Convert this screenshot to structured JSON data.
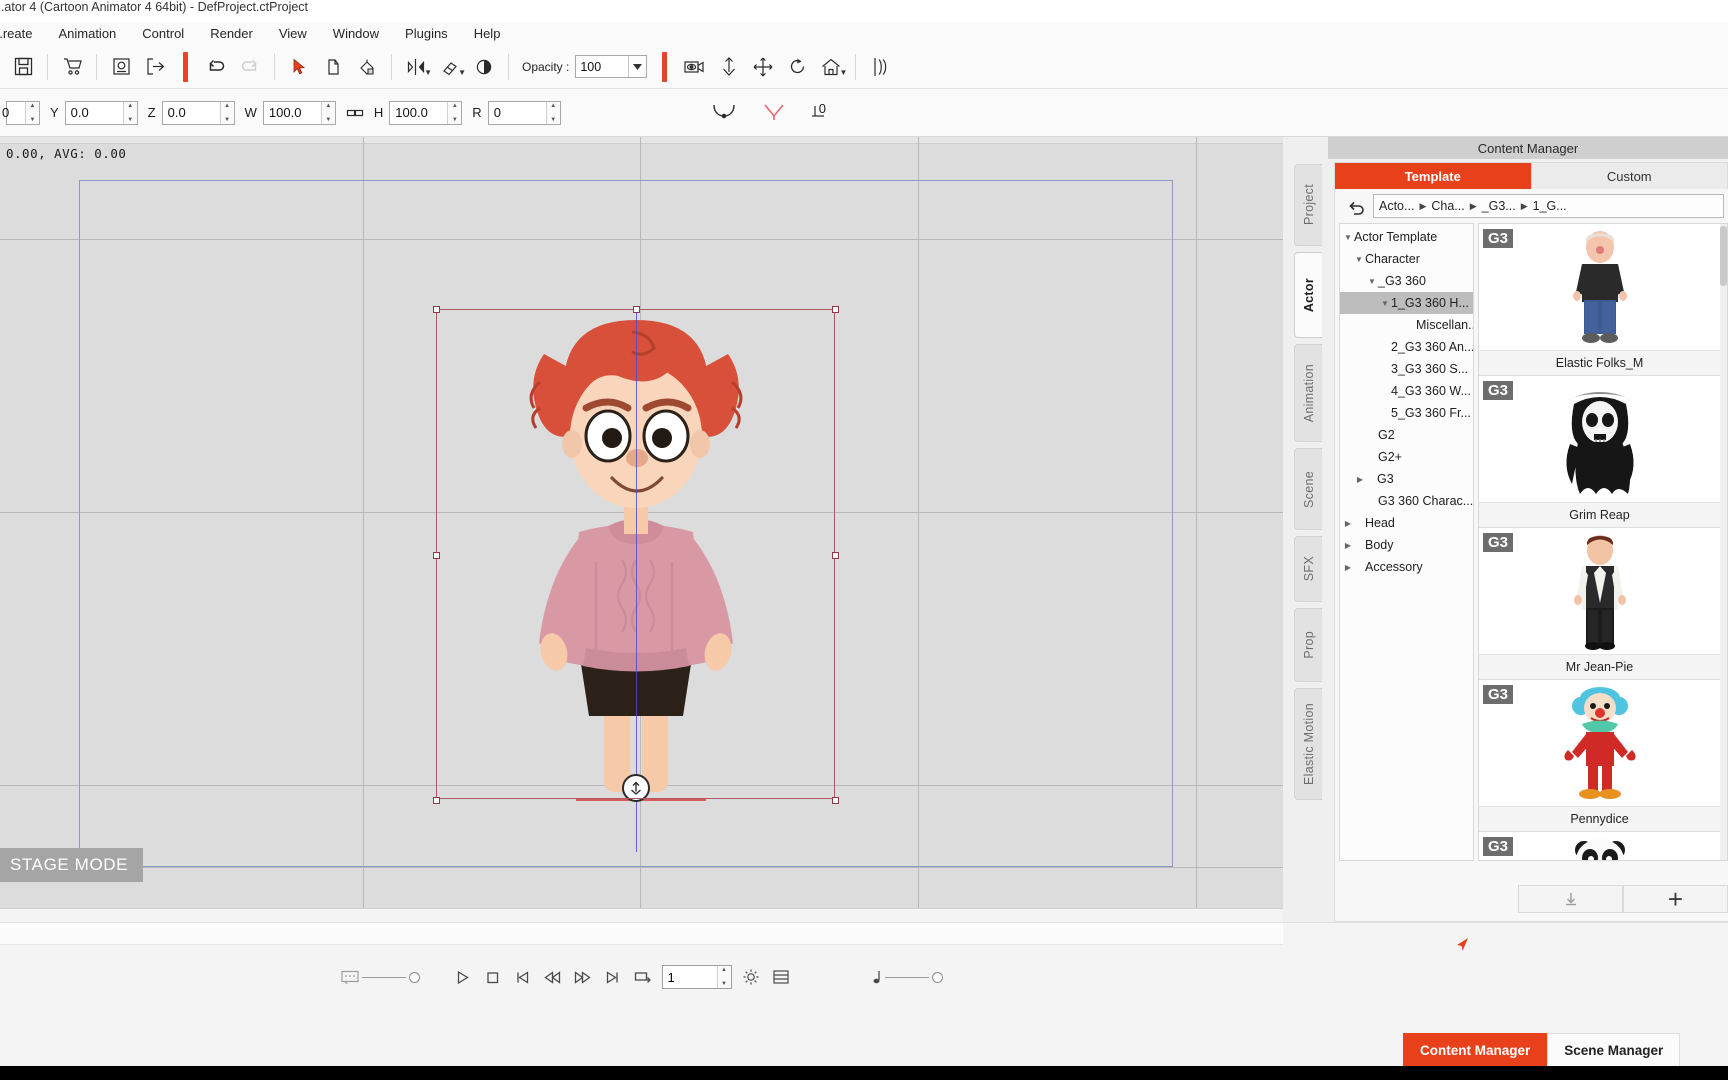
{
  "window": {
    "title": "...ator 4  (Cartoon Animator 4 64bit) - DefProject.ctProject"
  },
  "menu": {
    "items": [
      {
        "label": "...reate"
      },
      {
        "label": "Animation"
      },
      {
        "label": "Control"
      },
      {
        "label": "Render"
      },
      {
        "label": "View"
      },
      {
        "label": "Window"
      },
      {
        "label": "Plugins"
      },
      {
        "label": "Help"
      }
    ]
  },
  "toolbar": {
    "save_label": "save-icon",
    "opacity_label": "Opacity :",
    "opacity_value": "100"
  },
  "transform": {
    "fields": [
      {
        "key": "",
        "value": "0"
      },
      {
        "key": "Y",
        "value": "0.0"
      },
      {
        "key": "Z",
        "value": "0.0"
      },
      {
        "key": "W",
        "value": "100.0"
      },
      {
        "key": "H",
        "value": "100.0"
      },
      {
        "key": "R",
        "value": "0"
      }
    ],
    "angle_value": "0"
  },
  "viewport": {
    "readout": "0.00,  AVG: 0.00",
    "stage_mode": "STAGE MODE"
  },
  "dock": {
    "title": "Content Manager",
    "vtabs": [
      {
        "label": "Project",
        "active": false
      },
      {
        "label": "Actor",
        "active": true
      },
      {
        "label": "Animation",
        "active": false
      },
      {
        "label": "Scene",
        "active": false
      },
      {
        "label": "SFX",
        "active": false
      },
      {
        "label": "Prop",
        "active": false
      },
      {
        "label": "Elastic Motion",
        "active": false
      }
    ],
    "tabs": [
      {
        "label": "Template",
        "active": true
      },
      {
        "label": "Custom",
        "active": false
      }
    ],
    "breadcrumb": [
      "Acto...",
      "Cha...",
      "_G3...",
      "1_G..."
    ],
    "tree": [
      {
        "label": "Actor Template",
        "depth": 0,
        "arrow": "down",
        "selected": false
      },
      {
        "label": "Character",
        "depth": 1,
        "arrow": "down",
        "selected": false
      },
      {
        "label": "_G3 360",
        "depth": 2,
        "arrow": "down",
        "selected": false
      },
      {
        "label": "1_G3 360 H...",
        "depth": 3,
        "arrow": "down",
        "selected": true
      },
      {
        "label": "Miscellan...",
        "depth": 4,
        "arrow": "none",
        "selected": false
      },
      {
        "label": "2_G3 360 An...",
        "depth": 3,
        "arrow": "none",
        "selected": false
      },
      {
        "label": "3_G3 360 S...",
        "depth": 3,
        "arrow": "none",
        "selected": false
      },
      {
        "label": "4_G3 360 W...",
        "depth": 3,
        "arrow": "none",
        "selected": false
      },
      {
        "label": "5_G3 360 Fr...",
        "depth": 3,
        "arrow": "none",
        "selected": false
      },
      {
        "label": "G2",
        "depth": 2,
        "arrow": "none",
        "selected": false
      },
      {
        "label": "G2+",
        "depth": 2,
        "arrow": "none",
        "selected": false
      },
      {
        "label": "G3",
        "depth": 2,
        "arrow": "right",
        "selected": false
      },
      {
        "label": "G3 360 Charac...",
        "depth": 2,
        "arrow": "none",
        "selected": false
      },
      {
        "label": "Head",
        "depth": 1,
        "arrow": "right",
        "selected": false
      },
      {
        "label": "Body",
        "depth": 1,
        "arrow": "right",
        "selected": false
      },
      {
        "label": "Accessory",
        "depth": 1,
        "arrow": "right",
        "selected": false
      }
    ],
    "items": [
      {
        "badge": "G3",
        "name": "Elastic Folks_M",
        "kind": "man-blue-jeans"
      },
      {
        "badge": "G3",
        "name": "Grim Reap",
        "kind": "grim-reaper"
      },
      {
        "badge": "G3",
        "name": "Mr Jean-Pie",
        "kind": "man-suit"
      },
      {
        "badge": "G3",
        "name": "Pennydice",
        "kind": "clown"
      },
      {
        "badge": "G3",
        "name": "",
        "kind": "panda"
      }
    ],
    "footer": {
      "download_label": "download-icon",
      "add_label": "+"
    }
  },
  "playback": {
    "frame_value": "1"
  },
  "bottom_tabs": [
    {
      "label": "Content Manager",
      "active": true
    },
    {
      "label": "Scene Manager",
      "active": false
    }
  ],
  "colors": {
    "accent": "#e8401b",
    "accent_bar": "#e8412a",
    "selection": "#b05663",
    "pivot": "#4b4bd0"
  }
}
